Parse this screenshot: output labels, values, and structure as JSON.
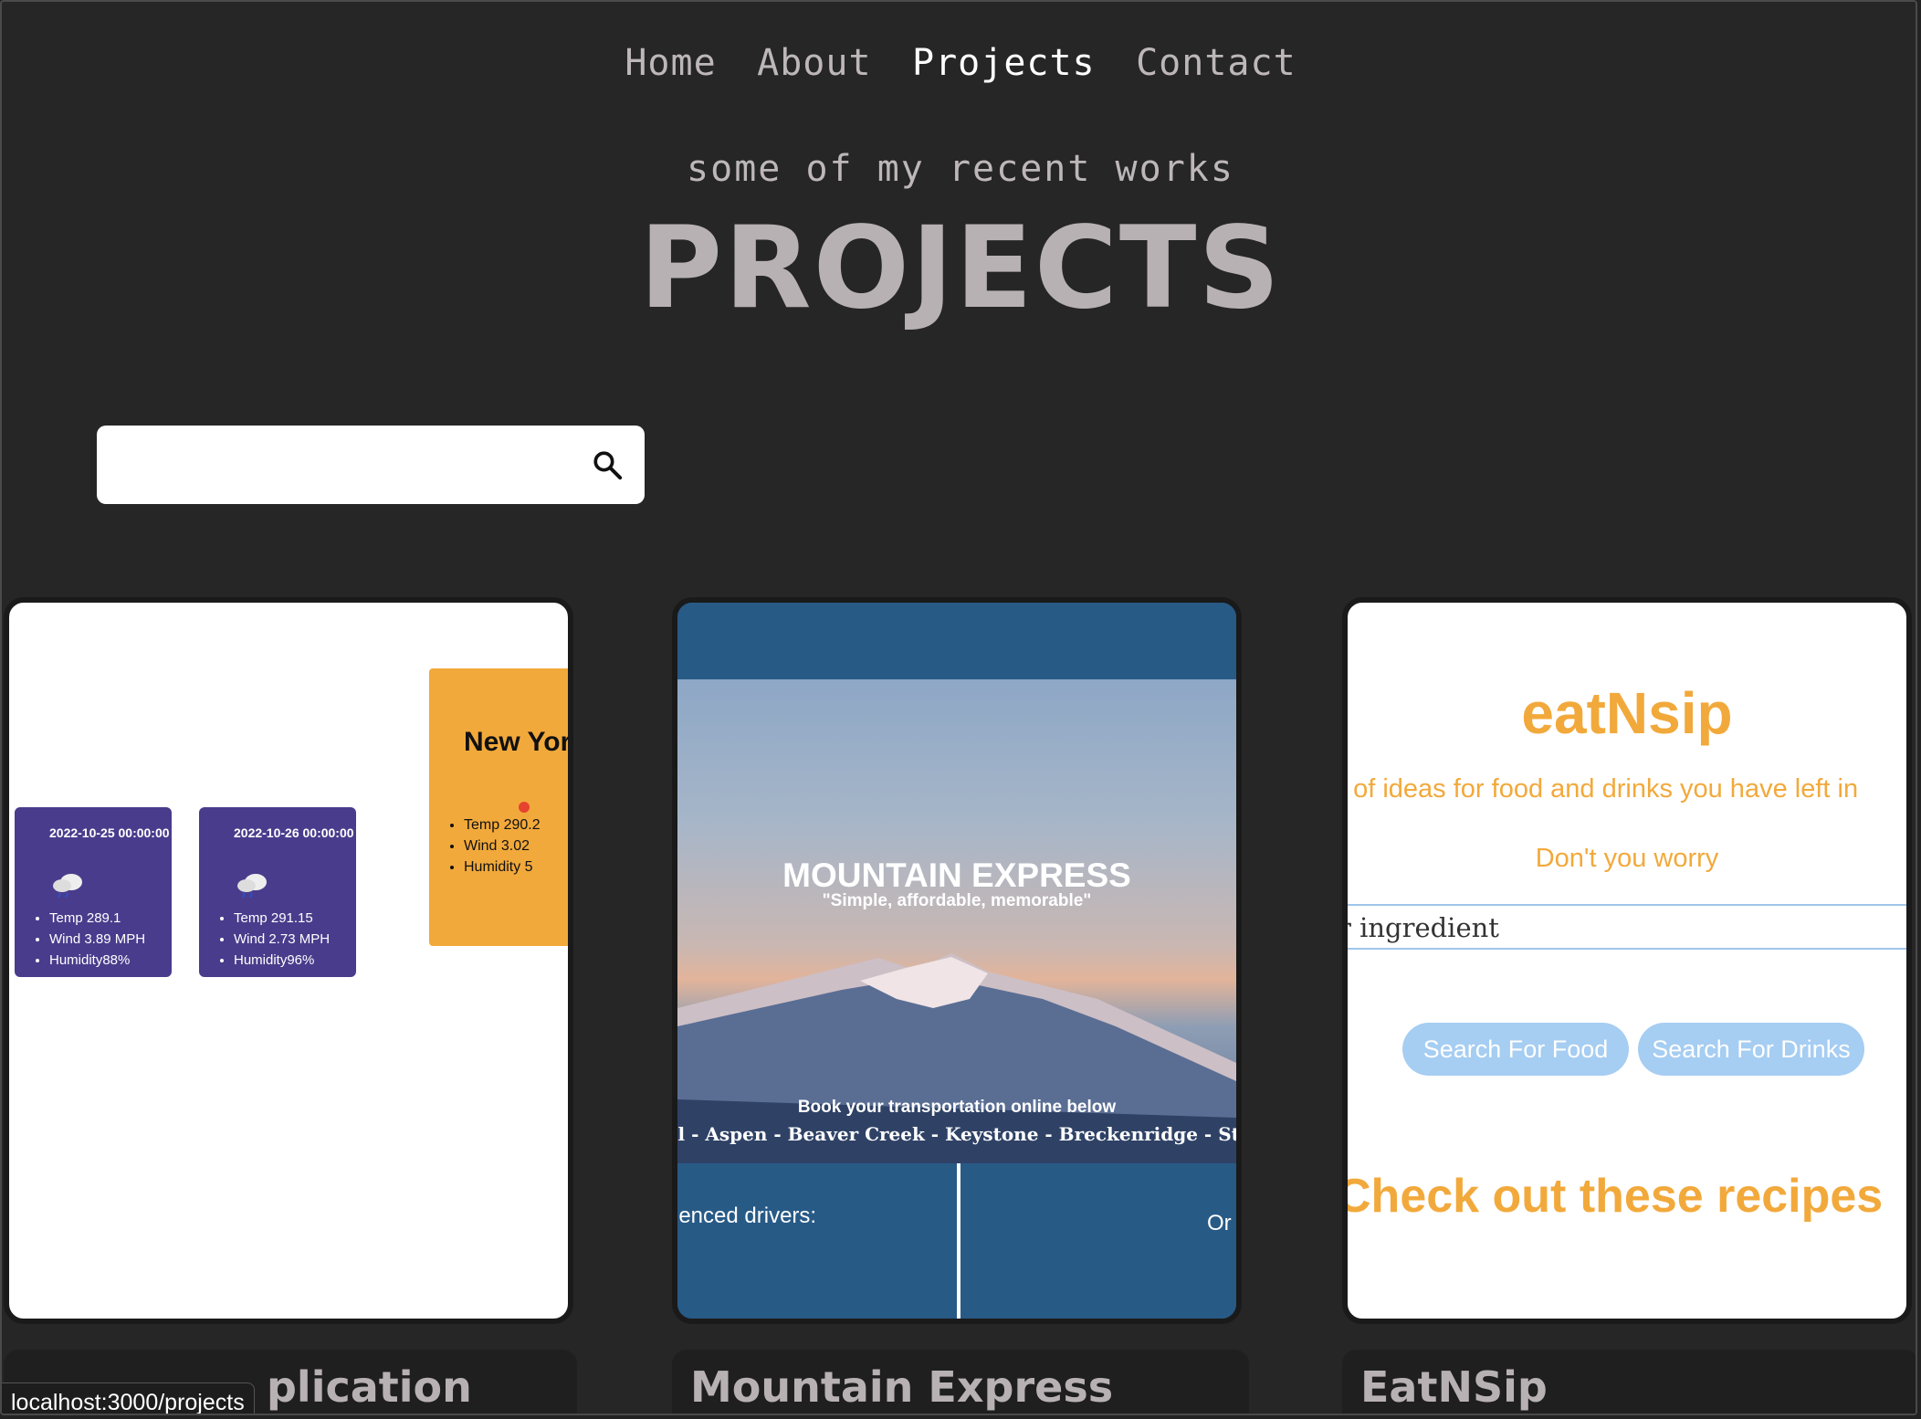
{
  "nav": {
    "home": "Home",
    "about": "About",
    "projects": "Projects",
    "contact": "Contact"
  },
  "hero": {
    "subtitle": "some of my recent works",
    "title": "PROJECTS"
  },
  "search": {
    "value": "",
    "icon": "search-icon"
  },
  "projects": [
    {
      "name": "Weather Application",
      "name_visible": "plication",
      "preview": {
        "days": [
          {
            "date": "2022-10-25 00:00:00",
            "temp": "Temp 289.1",
            "wind": "Wind 3.89 MPH",
            "humidity": "Humidity88%"
          },
          {
            "date": "2022-10-26 00:00:00",
            "temp": "Temp 291.15",
            "wind": "Wind 2.73 MPH",
            "humidity": "Humidity96%"
          }
        ],
        "current": {
          "city": "New Yor",
          "temp": "Temp 290.2",
          "wind": "Wind 3.02",
          "humidity": "Humidity 5"
        }
      }
    },
    {
      "name": "Mountain Express",
      "preview": {
        "heading": "MOUNTAIN EXPRESS",
        "tagline": "\"Simple, affordable, memorable\"",
        "book": "Book your transportation online below",
        "places": "ail - Aspen - Beaver Creek - Keystone - Breckenridge - Steamboa",
        "drivers": "ienced drivers:",
        "or": "Or c"
      }
    },
    {
      "name": "EatNSip",
      "preview": {
        "logo": "eatNsip",
        "ideas": "t of ideas for food and drinks you have left in",
        "worry": "Don't you worry",
        "input_value": "r ingredient",
        "btn_food": "Search For Food",
        "btn_drinks": "Search For Drinks",
        "check": "Check out these recipes"
      }
    }
  ],
  "status_bar": {
    "url": "localhost:3000/projects"
  },
  "colors": {
    "bg": "#262626",
    "text": "#bdb7b9",
    "accent": "#f2a93b",
    "mountain_blue": "#285a86",
    "weather_purple": "#4a3c8c"
  }
}
